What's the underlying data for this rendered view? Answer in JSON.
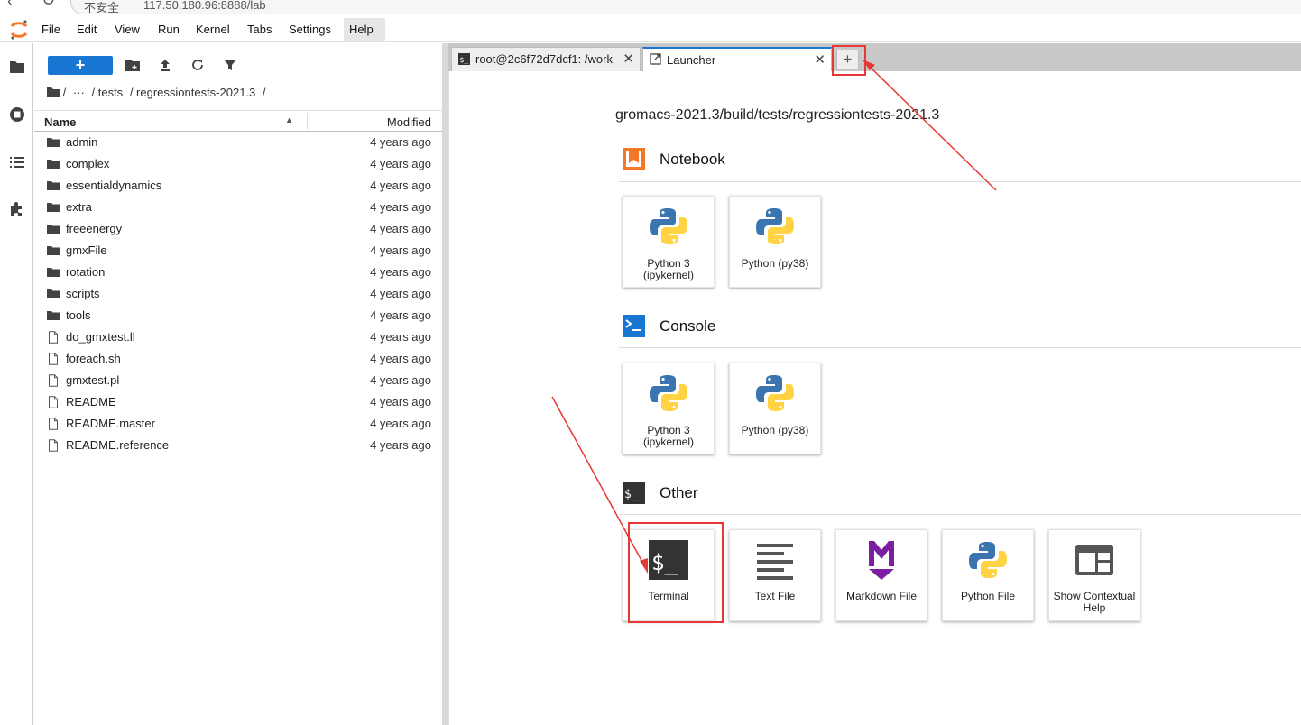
{
  "browser": {
    "url_prefix": "不安全",
    "url": "117.50.180.96:8888/lab"
  },
  "menubar": {
    "items": [
      "File",
      "Edit",
      "View",
      "Run",
      "Kernel",
      "Tabs",
      "Settings",
      "Help"
    ],
    "active": "Help"
  },
  "activity_bar": {
    "icons": [
      "folder-icon",
      "running-icon",
      "table-of-contents-icon",
      "extension-icon"
    ]
  },
  "file_browser": {
    "new_button_label": "+",
    "breadcrumb": [
      "/",
      "···",
      "/ tests",
      "/ regressiontests-2021.3",
      "/"
    ],
    "columns": {
      "name": "Name",
      "modified": "Modified"
    },
    "files": [
      {
        "name": "admin",
        "type": "folder",
        "modified": "4 years ago"
      },
      {
        "name": "complex",
        "type": "folder",
        "modified": "4 years ago"
      },
      {
        "name": "essentialdynamics",
        "type": "folder",
        "modified": "4 years ago"
      },
      {
        "name": "extra",
        "type": "folder",
        "modified": "4 years ago"
      },
      {
        "name": "freeenergy",
        "type": "folder",
        "modified": "4 years ago"
      },
      {
        "name": "gmxFile",
        "type": "folder",
        "modified": "4 years ago"
      },
      {
        "name": "rotation",
        "type": "folder",
        "modified": "4 years ago"
      },
      {
        "name": "scripts",
        "type": "folder",
        "modified": "4 years ago"
      },
      {
        "name": "tools",
        "type": "folder",
        "modified": "4 years ago"
      },
      {
        "name": "do_gmxtest.ll",
        "type": "file",
        "modified": "4 years ago"
      },
      {
        "name": "foreach.sh",
        "type": "file",
        "modified": "4 years ago"
      },
      {
        "name": "gmxtest.pl",
        "type": "file",
        "modified": "4 years ago"
      },
      {
        "name": "README",
        "type": "file",
        "modified": "4 years ago"
      },
      {
        "name": "README.master",
        "type": "file",
        "modified": "4 years ago"
      },
      {
        "name": "README.reference",
        "type": "file",
        "modified": "4 years ago"
      }
    ]
  },
  "tabs": [
    {
      "label": "root@2c6f72d7dcf1: /work",
      "close": "✕",
      "icon": "terminal-icon"
    },
    {
      "label": "Launcher",
      "close": "✕",
      "icon": "launcher-icon"
    }
  ],
  "add_tab_label": "+",
  "launcher": {
    "cwd": "gromacs-2021.3/build/tests/regressiontests-2021.3",
    "sections": [
      {
        "title": "Notebook",
        "cards": [
          {
            "label": "Python 3 (ipykernel)",
            "icon": "python-icon"
          },
          {
            "label": "Python (py38)",
            "icon": "python-icon"
          }
        ]
      },
      {
        "title": "Console",
        "cards": [
          {
            "label": "Python 3 (ipykernel)",
            "icon": "python-icon"
          },
          {
            "label": "Python (py38)",
            "icon": "python-icon"
          }
        ]
      },
      {
        "title": "Other",
        "cards": [
          {
            "label": "Terminal",
            "icon": "terminal-icon"
          },
          {
            "label": "Text File",
            "icon": "text-file-icon"
          },
          {
            "label": "Markdown File",
            "icon": "markdown-icon"
          },
          {
            "label": "Python File",
            "icon": "python-icon"
          },
          {
            "label": "Show Contextual Help",
            "icon": "contextual-help-icon"
          }
        ]
      }
    ]
  },
  "colors": {
    "accent": "#1976d2",
    "annotation": "#e53935",
    "notebook": "#f37726",
    "python_blue": "#3a75b0",
    "python_yellow": "#ffd343",
    "markdown": "#7b1fa2"
  }
}
